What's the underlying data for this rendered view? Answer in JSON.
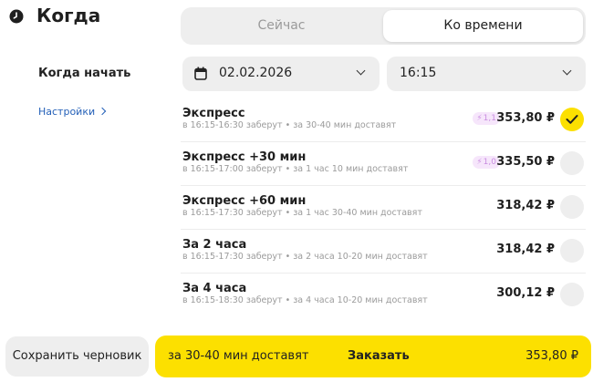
{
  "header": {
    "title": "Когда",
    "icon": "clock-icon"
  },
  "mode_tabs": [
    {
      "label": "Сейчас",
      "selected": false
    },
    {
      "label": "Ко времени",
      "selected": true
    }
  ],
  "start": {
    "label": "Когда начать",
    "date": "02.02.2026",
    "time": "16:15"
  },
  "settings_link": "Настройки",
  "options": [
    {
      "name": "Экспресс",
      "sub": "в 16:15-16:30 заберут • за 30-40 мин доставят",
      "surge": "1,1",
      "price": "353,80 ₽",
      "selected": true
    },
    {
      "name": "Экспресс +30 мин",
      "sub": "в 16:15-17:00 заберут • за 1 час 10 мин доставят",
      "surge": "1,0",
      "price": "335,50 ₽",
      "selected": false
    },
    {
      "name": "Экспресс +60 мин",
      "sub": "в 16:15-17:30 заберут • за 1 час 30-40 мин доставят",
      "surge": "",
      "price": "318,42 ₽",
      "selected": false
    },
    {
      "name": "За 2 часа",
      "sub": "в 16:15-17:30 заберут • за 2 часа 10-20 мин доставят",
      "surge": "",
      "price": "318,42 ₽",
      "selected": false
    },
    {
      "name": "За 4 часа",
      "sub": "в 16:15-18:30 заберут • за 4 часа 10-20 мин доставят",
      "surge": "",
      "price": "300,12 ₽",
      "selected": false
    }
  ],
  "footer": {
    "save_label": "Сохранить черновик",
    "order_eta": "за 30-40 мин доставят",
    "order_label": "Заказать",
    "order_price": "353,80 ₽"
  },
  "colors": {
    "accent": "#fce000",
    "link": "#2460b8",
    "surge": "#c98de0"
  }
}
